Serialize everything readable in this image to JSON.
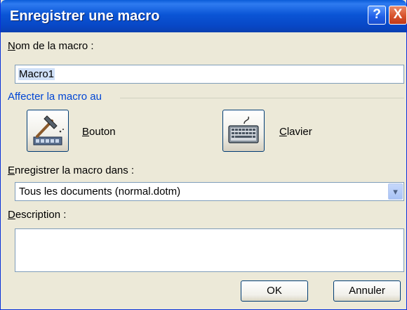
{
  "window": {
    "title": "Enregistrer une macro",
    "help_label": "?",
    "close_label": "X"
  },
  "macro_name": {
    "label": "Nom de la macro :",
    "label_hotkey": "N",
    "label_rest": "om de la macro :",
    "value": "Macro1"
  },
  "assign": {
    "title": "Affecter la macro au",
    "button_label_hotkey": "B",
    "button_label_rest": "outon",
    "keyboard_label_hotkey": "C",
    "keyboard_label_rest": "lavier",
    "button_icon": "hammer-toolbar-icon",
    "keyboard_icon": "keyboard-icon"
  },
  "store": {
    "label_hotkey": "E",
    "label_rest": "nregistrer la macro dans :",
    "value": "Tous les documents (normal.dotm)",
    "arrow": "▾"
  },
  "description": {
    "label_hotkey": "D",
    "label_rest": "escription :",
    "value": ""
  },
  "footer": {
    "ok_label": "OK",
    "cancel_label": "Annuler"
  }
}
